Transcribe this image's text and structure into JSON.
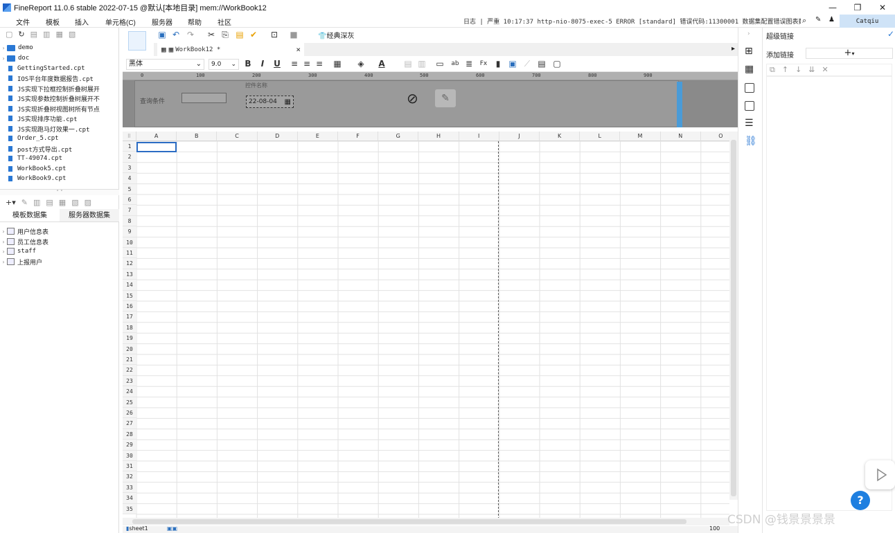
{
  "window": {
    "title": "FineReport 11.0.6 stable 2022-07-15 @默认[本地目录]    mem://WorkBook12",
    "minimize": "—",
    "restore": "❐",
    "close": "✕"
  },
  "menu": {
    "items": [
      "文件",
      "模板",
      "插入",
      "单元格(C)",
      "服务器",
      "帮助",
      "社区"
    ],
    "log": "日志 | 严重 10:17:37 http-nio-8075-exec-5 ERROR [standard] 错误代码:11300001 数据集配置错误图表数...",
    "user": "Catqiu"
  },
  "file_tree": {
    "folders": [
      "demo",
      "doc"
    ],
    "files": [
      "GettingStarted.cpt",
      "IOS平台年度数据报告.cpt",
      "JS实现下拉框控制折叠树展开",
      "JS实现参数控制折叠树展开不",
      "JS实现折叠树视图树所有节点",
      "JS实现排序功能.cpt",
      "JS实现跑马灯效果一.cpt",
      "Order_5.cpt",
      "post方式导出.cpt",
      "TT-49074.cpt",
      "WorkBook5.cpt",
      "WorkBook9.cpt"
    ]
  },
  "dataset": {
    "tabs": [
      "模板数据集",
      "服务器数据集"
    ],
    "items": [
      "用户信息表",
      "员工信息表",
      "staff",
      "上报用户"
    ]
  },
  "toolbar": {
    "theme_label": "经典深灰"
  },
  "doc_tab": {
    "name": "WorkBook12 *",
    "close": "×"
  },
  "format": {
    "font": "黑体",
    "size": "9.0",
    "bold": "B",
    "italic": "I",
    "underline": "U"
  },
  "param_pane": {
    "ruler": [
      "0",
      "100",
      "200",
      "300",
      "400",
      "500",
      "600",
      "700",
      "800",
      "900"
    ],
    "query_label": "查询条件",
    "widget_label": "控件名称",
    "date_value": "22-08-04"
  },
  "sheet": {
    "columns": [
      "A",
      "B",
      "C",
      "D",
      "E",
      "F",
      "G",
      "H",
      "I",
      "J",
      "K",
      "L",
      "M",
      "N",
      "O"
    ],
    "rows": [
      "1",
      "2",
      "3",
      "4",
      "5",
      "6",
      "7",
      "8",
      "9",
      "10",
      "11",
      "12",
      "13",
      "14",
      "15",
      "16",
      "17",
      "18",
      "19",
      "20",
      "21",
      "22",
      "23",
      "24",
      "25",
      "26",
      "27",
      "28",
      "29",
      "30",
      "31",
      "32",
      "33",
      "34",
      "35"
    ],
    "tab": "sheet1",
    "zoom": "100"
  },
  "right_panel": {
    "title": "超级链接",
    "add_link_label": "添加链接"
  },
  "watermark": "CSDN @钱景景景景",
  "help_label": "?"
}
